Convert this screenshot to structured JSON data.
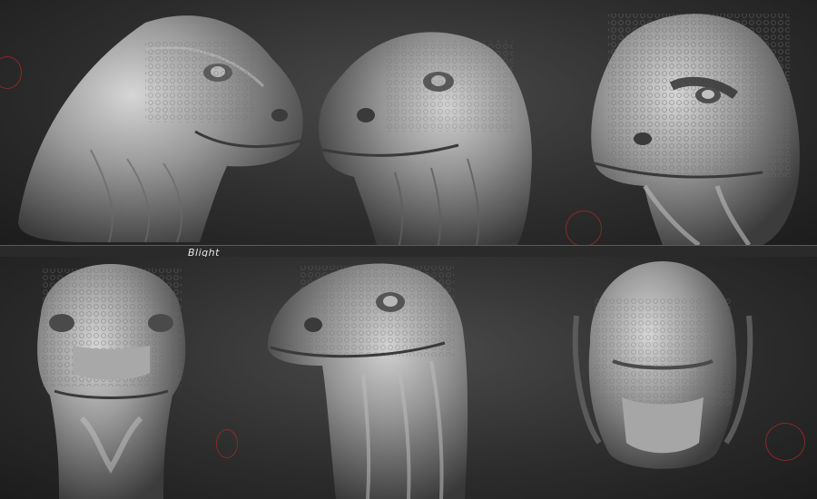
{
  "artwork": {
    "signature": "Blight",
    "subject": "lizard-head-sculpt",
    "views": [
      {
        "name": "side-right"
      },
      {
        "name": "three-quarter-left"
      },
      {
        "name": "three-quarter-textured"
      },
      {
        "name": "front"
      },
      {
        "name": "three-quarter-low"
      },
      {
        "name": "top"
      }
    ]
  },
  "colors": {
    "background": "#2a2a2a",
    "clay_light": "#cfcfcf",
    "clay_mid": "#8c8c8c",
    "clay_dark": "#3a3a3a",
    "marker_ring": "#aa2828"
  }
}
